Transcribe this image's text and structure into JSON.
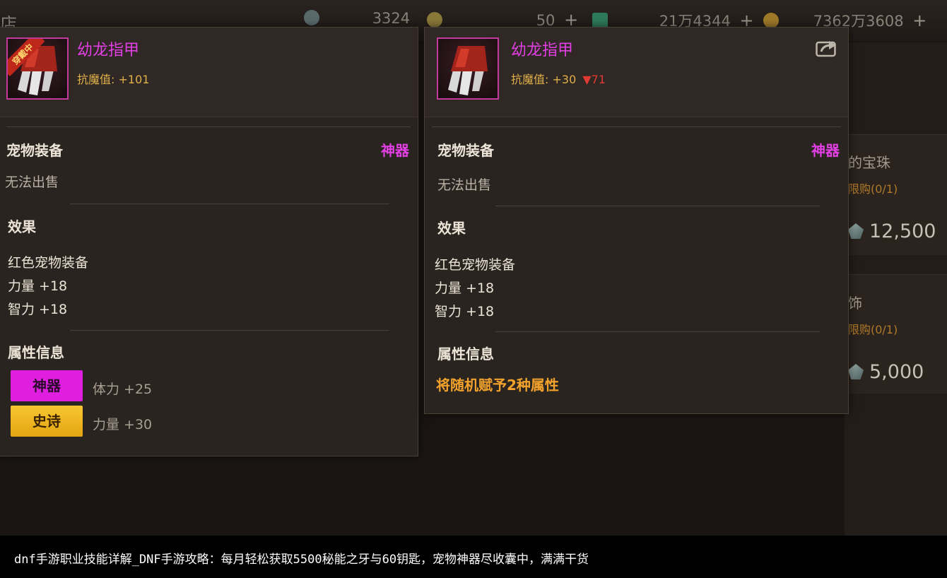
{
  "topbar": {
    "shop_title": "店",
    "currencies": [
      {
        "value": "3324",
        "icon": "gem-icon"
      },
      {
        "value": "50",
        "icon": "coin-icon",
        "plus": "+"
      },
      {
        "value": "21万4344",
        "icon": "crystal-icon",
        "plus": "+"
      },
      {
        "value": "7362万3608",
        "icon": "gold-icon",
        "plus": "+"
      }
    ]
  },
  "shop": {
    "items": [
      {
        "name": "的宝珠",
        "limit": "限购(0/1)",
        "price": "12,500"
      },
      {
        "name": "饰",
        "limit": "限购(0/1)",
        "price": "5,000"
      }
    ]
  },
  "left_panel": {
    "equipped_badge": "穿戴中",
    "name": "幼龙指甲",
    "stat_label": "抗魔值:",
    "stat_value": "+101",
    "category": "宠物装备",
    "grade": "神器",
    "sell_status": "无法出售",
    "effect_title": "效果",
    "effects": [
      "红色宠物装备",
      "力量 +18",
      "智力 +18"
    ],
    "attr_title": "属性信息",
    "attrs": [
      {
        "tag": "神器",
        "value": "体力 +25"
      },
      {
        "tag": "史诗",
        "value": "力量 +30"
      }
    ]
  },
  "right_panel": {
    "name": "幼龙指甲",
    "stat_label": "抗魔值:",
    "stat_value": "+30",
    "stat_diff": "▼71",
    "category": "宠物装备",
    "grade": "神器",
    "sell_status": "无法出售",
    "effect_title": "效果",
    "effects": [
      "红色宠物装备",
      "力量 +18",
      "智力 +18"
    ],
    "attr_title": "属性信息",
    "attr_random": "将随机赋予2种属性"
  },
  "caption": "dnf手游职业技能详解_DNF手游攻略：每月轻松获取5500秘能之牙与60钥匙，宠物神器尽收囊中，满满干货",
  "colors": {
    "artifact_pink": "#e23fe4",
    "epic_gold": "#f0b820",
    "stat_gold": "#e0b14a",
    "decrease_red": "#e23a32",
    "random_orange": "#f3a22c"
  }
}
